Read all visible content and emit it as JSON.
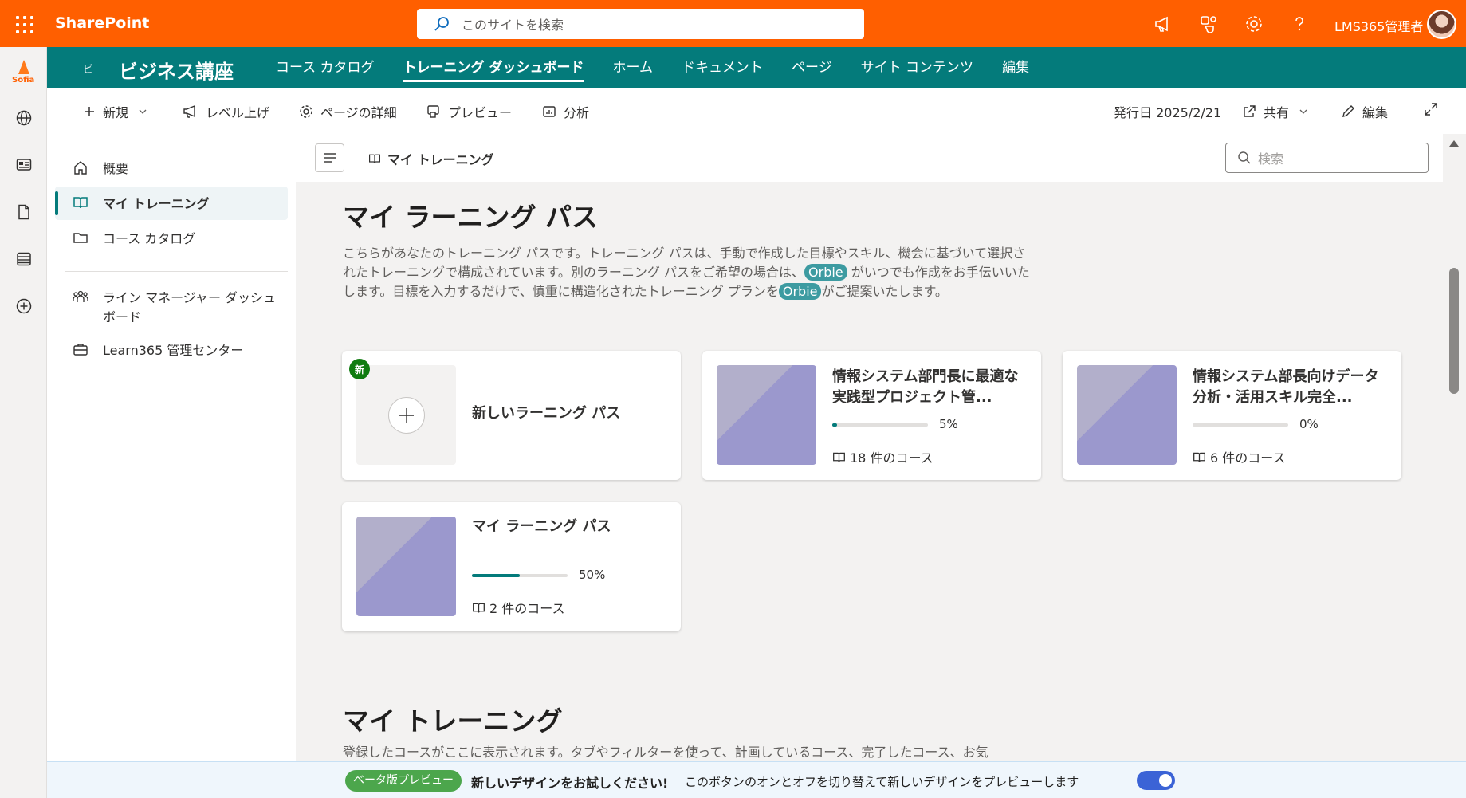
{
  "suite": {
    "app_name": "SharePoint",
    "search_placeholder": "このサイトを検索",
    "user_name": "LMS365管理者"
  },
  "rail": {
    "logo_text": "Sofia"
  },
  "site": {
    "logo_text": "ビ",
    "title": "ビジネス講座",
    "nav": [
      {
        "label": "コース カタログ",
        "active": false
      },
      {
        "label": "トレーニング ダッシュボード",
        "active": true
      },
      {
        "label": "ホーム",
        "active": false
      },
      {
        "label": "ドキュメント",
        "active": false
      },
      {
        "label": "ページ",
        "active": false
      },
      {
        "label": "サイト コンテンツ",
        "active": false
      },
      {
        "label": "編集",
        "active": false
      }
    ]
  },
  "commands": {
    "new": "新規",
    "boost": "レベル上げ",
    "page_details": "ページの詳細",
    "preview": "プレビュー",
    "analytics": "分析",
    "published": "発行日 2025/2/21",
    "share": "共有",
    "edit": "編集"
  },
  "leftnav": {
    "items": [
      {
        "label": "概要"
      },
      {
        "label": "マイ トレーニング"
      },
      {
        "label": "コース カタログ"
      },
      {
        "label": "ライン マネージャー ダッシュボード"
      },
      {
        "label": "Learn365 管理センター"
      }
    ]
  },
  "content": {
    "breadcrumb": "マイ トレーニング",
    "search_placeholder": "検索",
    "lp_heading": "マイ ラーニング パス",
    "lp_desc_1": "こちらがあなたのトレーニング パスです。トレーニング パスは、手動で作成した目標やスキル、機会に基づいて選択されたトレーニングで構成されています。別のラーニング パスをご希望の場合は、",
    "orbie": "Orbie",
    "lp_desc_2": " がいつでも作成をお手伝いいたします。目標を入力するだけで、慎重に構造化されたトレーニング プランを",
    "lp_desc_3": "がご提案いたします。",
    "new_card": {
      "badge": "新",
      "title": "新しいラーニング パス"
    },
    "cards": [
      {
        "title": "情報システム部門長に最適な実践型プロジェクト管...",
        "progress": 5,
        "progress_label": "5%",
        "courses": "18 件のコース"
      },
      {
        "title": "情報システム部長向けデータ分析・活用スキル完全...",
        "progress": 0,
        "progress_label": "0%",
        "courses": "6 件のコース"
      },
      {
        "title": "マイ ラーニング パス",
        "progress": 50,
        "progress_label": "50%",
        "courses": "2 件のコース"
      }
    ],
    "training_heading": "マイ トレーニング",
    "training_desc": "登録したコースがここに表示されます。タブやフィルターを使って、計画しているコース、完了したコース、お気"
  },
  "preview_bar": {
    "badge": "ベータ版プレビュー",
    "strong": "新しいデザインをお試しください!",
    "text": "このボタンのオンとオフを切り替えて新しいデザインをプレビューします"
  },
  "colors": {
    "suite_orange": "#ff5f00",
    "site_teal": "#047b7b",
    "orbie_pill": "#3d9ba1",
    "toggle_on": "#3b63d6"
  }
}
